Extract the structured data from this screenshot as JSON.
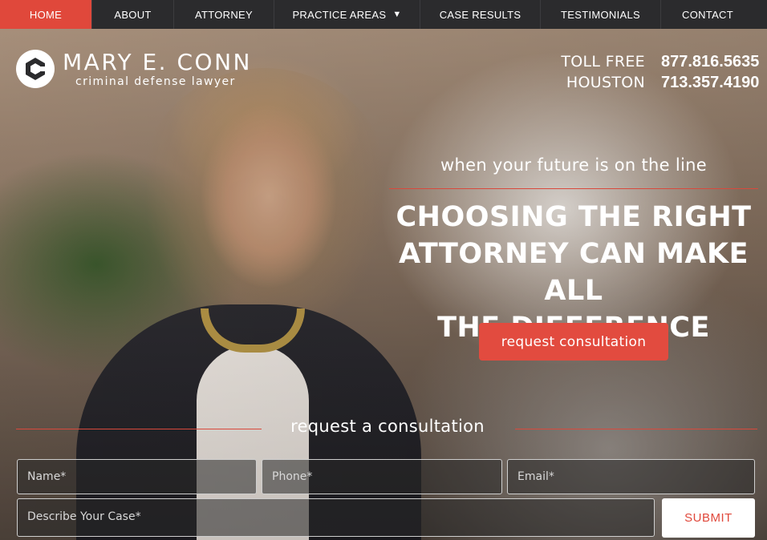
{
  "nav": {
    "items": [
      {
        "label": "HOME",
        "active": true
      },
      {
        "label": "ABOUT",
        "active": false
      },
      {
        "label": "ATTORNEY",
        "active": false
      },
      {
        "label": "PRACTICE AREAS",
        "active": false,
        "dropdown": true
      },
      {
        "label": "CASE RESULTS",
        "active": false
      },
      {
        "label": "TESTIMONIALS",
        "active": false
      },
      {
        "label": "CONTACT",
        "active": false
      }
    ],
    "caret_icon": "▼"
  },
  "logo": {
    "name": "MARY E. CONN",
    "subtitle": "criminal defense lawyer"
  },
  "phones": [
    {
      "label": "TOLL FREE",
      "number": "877.816.5635"
    },
    {
      "label": "HOUSTON",
      "number": "713.357.4190"
    }
  ],
  "hero": {
    "tagline": "when your future is on the line",
    "headline_lines": [
      "CHOOSING THE RIGHT",
      "ATTORNEY CAN MAKE ALL",
      "THE DIFFERENCE"
    ],
    "cta_label": "request consultation"
  },
  "form": {
    "title": "request a consultation",
    "name_placeholder": "Name*",
    "phone_placeholder": "Phone*",
    "email_placeholder": "Email*",
    "case_placeholder": "Describe Your Case*",
    "submit_label": "SUBMIT"
  },
  "colors": {
    "accent": "#e0483b",
    "nav_bg": "#2b2b2d"
  }
}
